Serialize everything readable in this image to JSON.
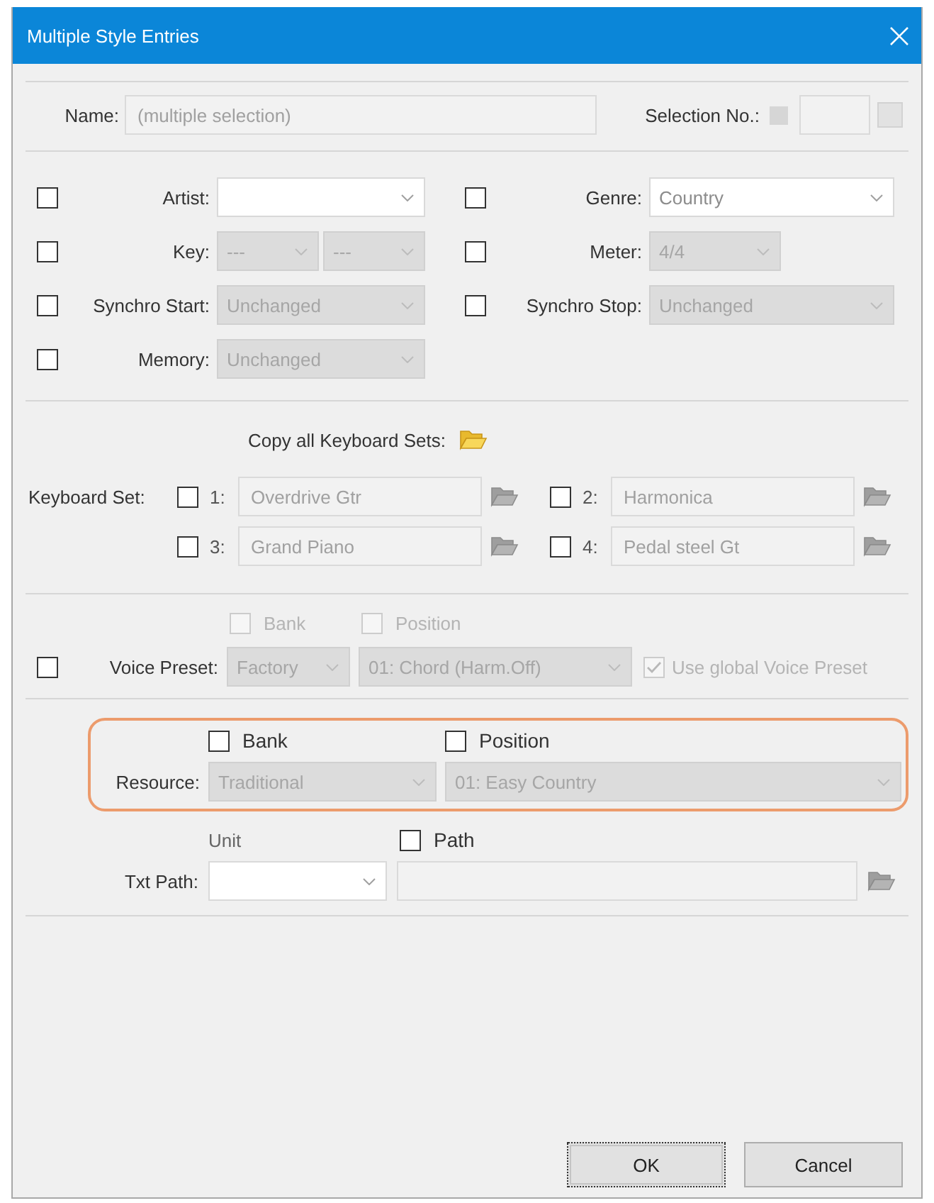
{
  "window": {
    "title": "Multiple Style Entries"
  },
  "name": {
    "label": "Name:",
    "value": "(multiple selection)",
    "disabled": true
  },
  "selection_no": {
    "label": "Selection No.:",
    "disabled": true
  },
  "style_rows": [
    {
      "cells": [
        {
          "label": "Artist:",
          "checked": false,
          "controls": [
            {
              "disabled": false
            }
          ]
        },
        {
          "label": "Genre:",
          "checked": false,
          "controls": [
            {
              "value": "Country",
              "disabled": false
            }
          ]
        }
      ]
    },
    {
      "cells": [
        {
          "label": "Key:",
          "checked": false,
          "controls": [
            {
              "value": "---",
              "disabled": true
            },
            {
              "value": "---",
              "disabled": true
            }
          ]
        },
        {
          "label": "Meter:",
          "checked": false,
          "controls": [
            {
              "value": "4/4",
              "disabled": true
            }
          ]
        }
      ]
    },
    {
      "cells": [
        {
          "label": "Synchro Start:",
          "checked": false,
          "controls": [
            {
              "value": "Unchanged",
              "disabled": true
            }
          ]
        },
        {
          "label": "Synchro Stop:",
          "checked": false,
          "controls": [
            {
              "value": "Unchanged",
              "disabled": true
            }
          ]
        }
      ]
    },
    {
      "cells": [
        {
          "label": "Memory:",
          "checked": false,
          "controls": [
            {
              "value": "Unchanged",
              "disabled": true
            }
          ]
        }
      ]
    }
  ],
  "keyboard_sets": {
    "copy_label": "Copy all Keyboard Sets:",
    "label": "Keyboard Set:",
    "sets": [
      {
        "number": "1:",
        "name": "Overdrive Gtr",
        "checked": false,
        "disabled": true
      },
      {
        "number": "2:",
        "name": "Harmonica",
        "checked": false,
        "disabled": true
      },
      {
        "number": "3:",
        "name": "Grand Piano",
        "checked": false,
        "disabled": true
      },
      {
        "number": "4:",
        "name": "Pedal steel Gt",
        "checked": false,
        "disabled": true
      }
    ]
  },
  "voice_preset": {
    "label": "Voice Preset:",
    "checked": false,
    "bank": {
      "label": "Bank",
      "checked": false,
      "disabled": true
    },
    "position": {
      "label": "Position",
      "checked": false,
      "disabled": true
    },
    "bank_value": {
      "value": "Factory",
      "disabled": true
    },
    "position_value": {
      "value": "01: Chord (Harm.Off)",
      "disabled": true
    },
    "use_global": {
      "label": "Use global Voice Preset",
      "checked": true,
      "disabled": true
    }
  },
  "resource": {
    "highlighted": true,
    "label": "Resource:",
    "bank": {
      "label": "Bank",
      "checked": false,
      "disabled": false
    },
    "position": {
      "label": "Position",
      "checked": false,
      "disabled": false
    },
    "bank_value": {
      "value": "Traditional",
      "disabled": true
    },
    "position_value": {
      "value": "01: Easy Country",
      "disabled": true
    }
  },
  "txt_path": {
    "label": "Txt Path:",
    "unit_label": "Unit",
    "path": {
      "label": "Path",
      "checked": false,
      "disabled": false
    },
    "unit": {
      "disabled": false
    },
    "path_field": {
      "disabled": true
    }
  },
  "buttons": [
    {
      "label": "OK",
      "focused": true
    },
    {
      "label": "Cancel",
      "focused": false
    }
  ]
}
